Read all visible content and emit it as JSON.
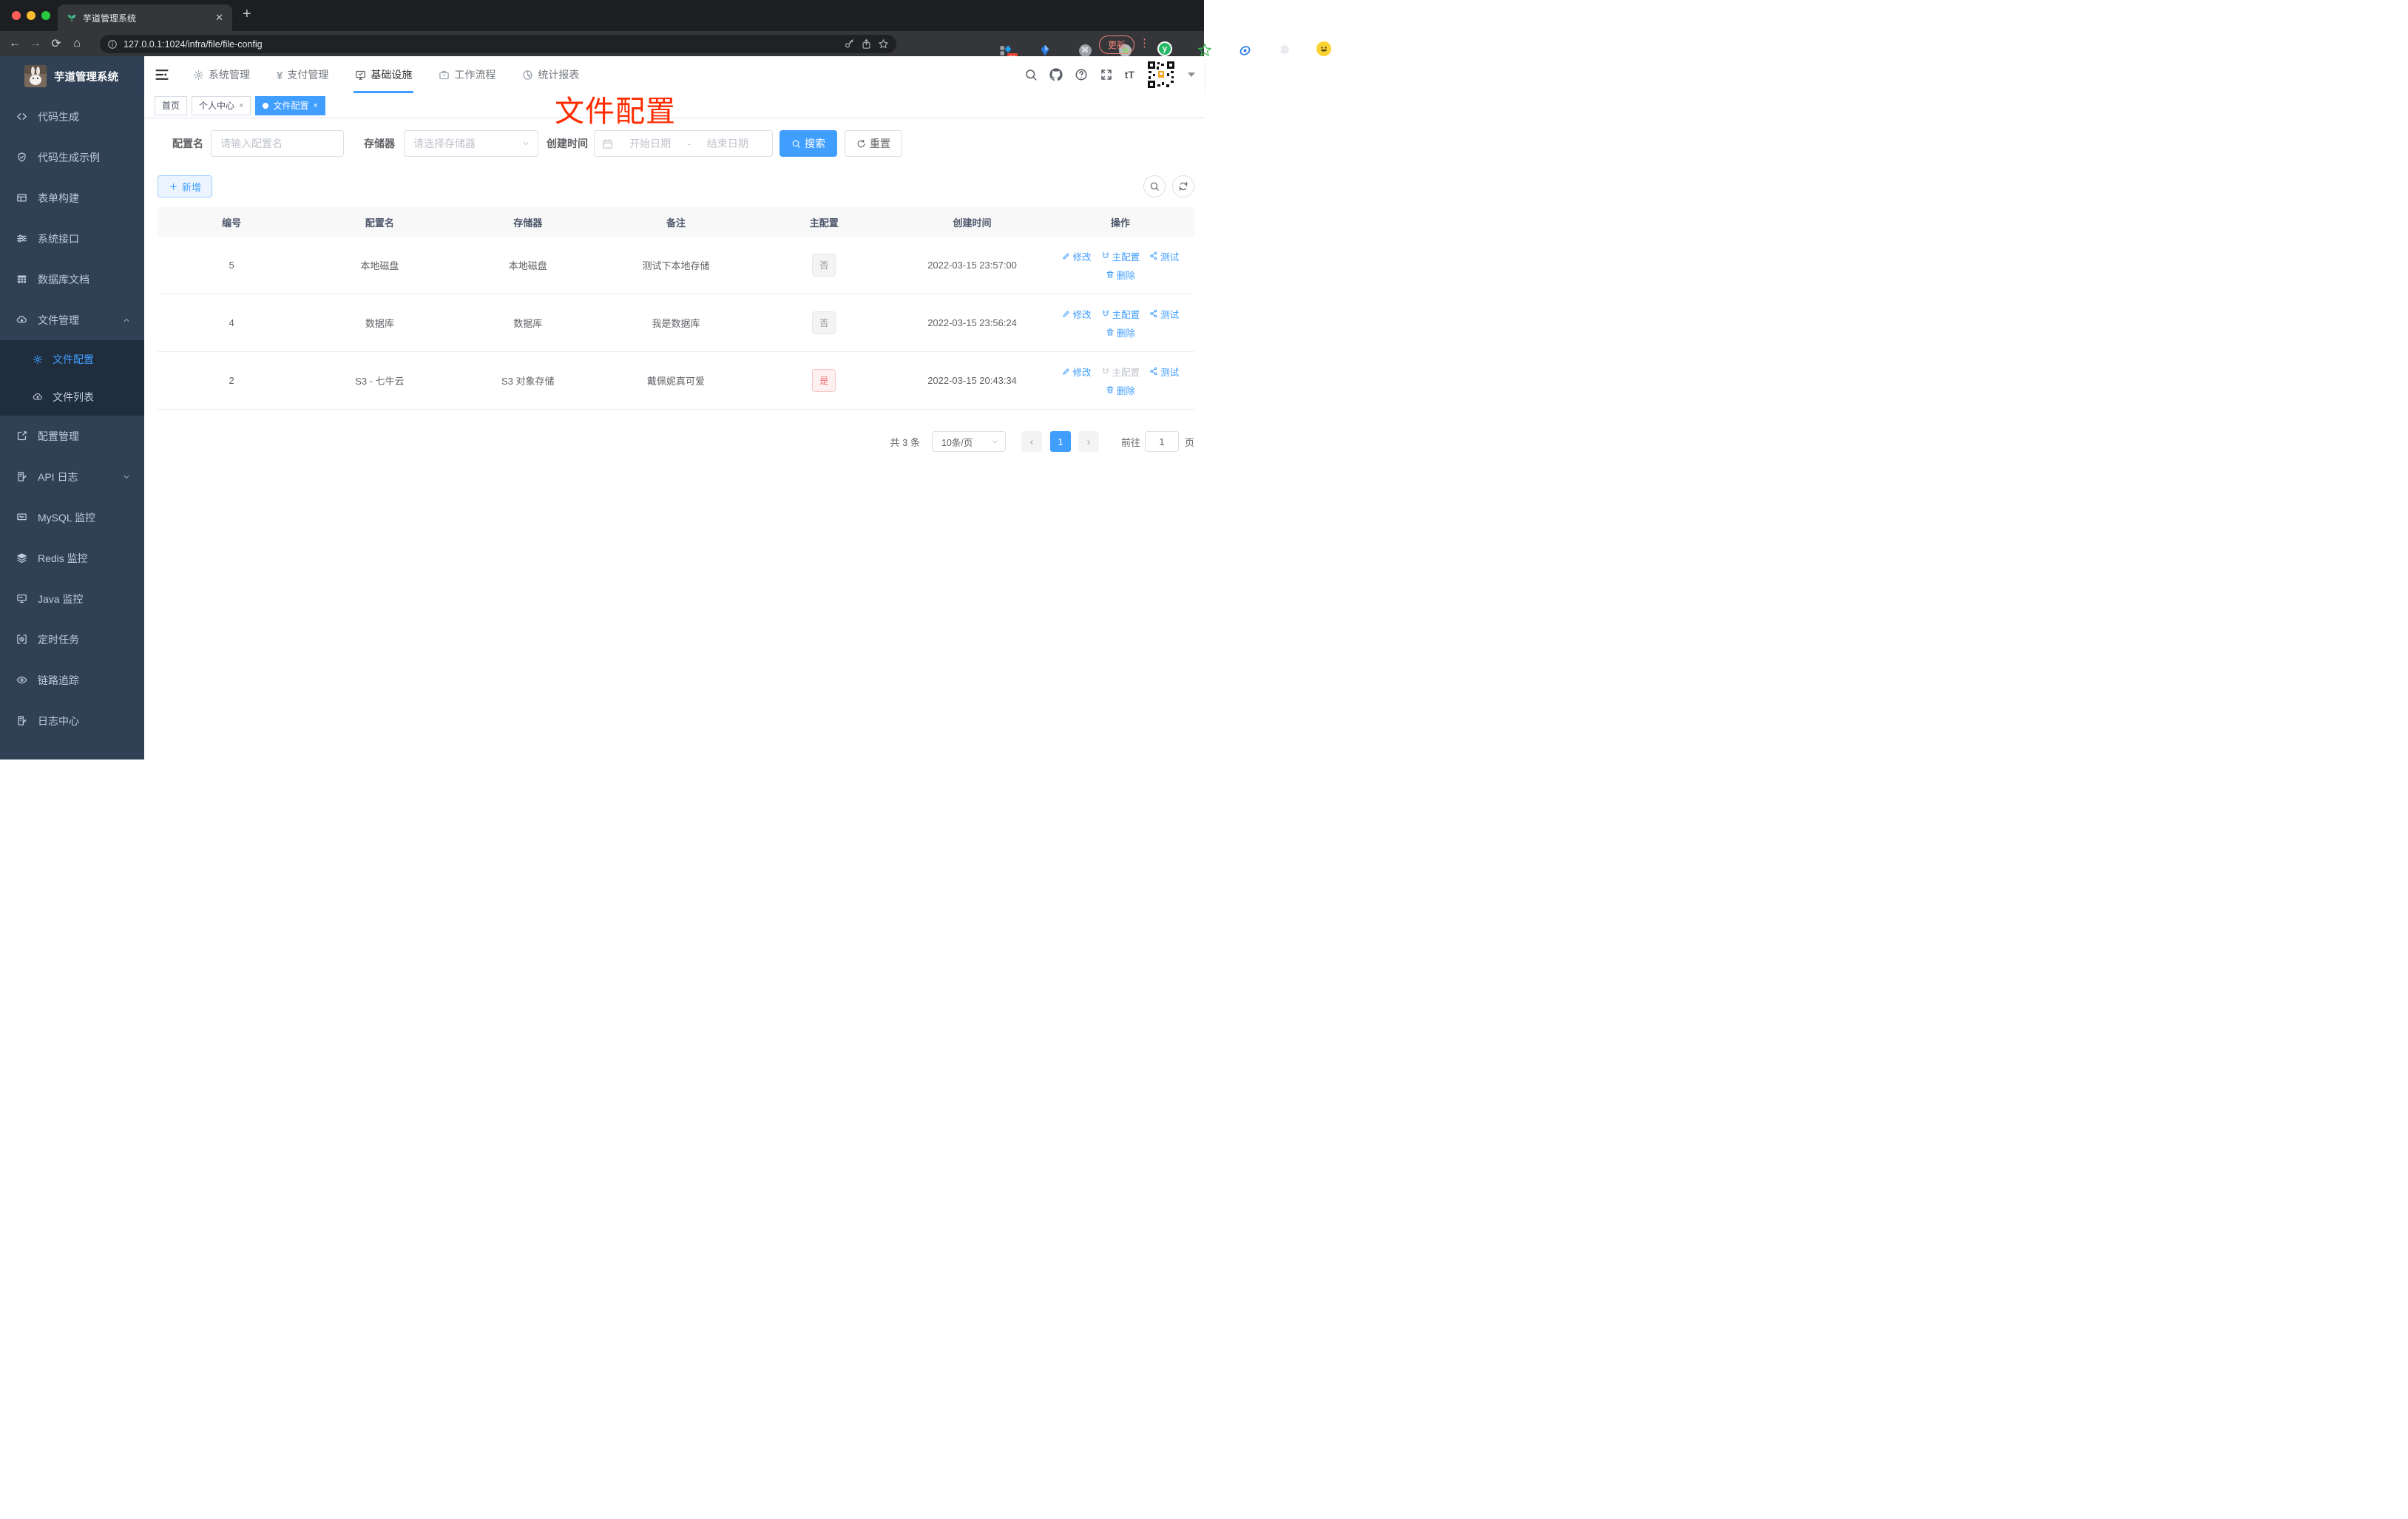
{
  "browser": {
    "tab_title": "芋道管理系统",
    "url": "127.0.0.1:1024/infra/file/file-config",
    "update_button": "更新",
    "extension_badge": "11"
  },
  "glyphs": {
    "close": "✕",
    "newtab": "+",
    "back": "←",
    "forward": "→",
    "reload": "⟳",
    "home": "⌂",
    "more": "⋮",
    "cmd": "⌘",
    "yen": "¥",
    "font_size": "tT",
    "prev": "‹",
    "next": "›",
    "dash": "-",
    "tab_close": "×"
  },
  "sidebar": {
    "title": "芋道管理系统",
    "items": [
      {
        "label": "代码生成"
      },
      {
        "label": "代码生成示例"
      },
      {
        "label": "表单构建"
      },
      {
        "label": "系统接口"
      },
      {
        "label": "数据库文档"
      },
      {
        "label": "文件管理"
      },
      {
        "label": "文件配置"
      },
      {
        "label": "文件列表"
      },
      {
        "label": "配置管理"
      },
      {
        "label": "API 日志"
      },
      {
        "label": "MySQL 监控"
      },
      {
        "label": "Redis 监控"
      },
      {
        "label": "Java 监控"
      },
      {
        "label": "定时任务"
      },
      {
        "label": "链路追踪"
      },
      {
        "label": "日志中心"
      }
    ]
  },
  "topnav": {
    "items": [
      {
        "label": "系统管理"
      },
      {
        "label": "支付管理"
      },
      {
        "label": "基础设施"
      },
      {
        "label": "工作流程"
      },
      {
        "label": "统计报表"
      }
    ]
  },
  "tags": {
    "home": "首页",
    "profile": "个人中心",
    "current": "文件配置"
  },
  "annotation": "文件配置",
  "filters": {
    "name_label": "配置名",
    "name_placeholder": "请输入配置名",
    "storage_label": "存储器",
    "storage_placeholder": "请选择存储器",
    "date_label": "创建时间",
    "date_start": "开始日期",
    "date_separator": "-",
    "date_end": "结束日期",
    "search": "搜索",
    "reset": "重置"
  },
  "toolbar": {
    "add": "新增"
  },
  "table": {
    "headers": [
      "编号",
      "配置名",
      "存储器",
      "备注",
      "主配置",
      "创建时间",
      "操作"
    ],
    "actions": {
      "edit": "修改",
      "master": "主配置",
      "test": "测试",
      "delete": "删除"
    },
    "rows": [
      {
        "id": "5",
        "name": "本地磁盘",
        "storage": "本地磁盘",
        "remark": "测试下本地存储",
        "master": "否",
        "created": "2022-03-15 23:57:00"
      },
      {
        "id": "4",
        "name": "数据库",
        "storage": "数据库",
        "remark": "我是数据库",
        "master": "否",
        "created": "2022-03-15 23:56:24"
      },
      {
        "id": "2",
        "name": "S3 - 七牛云",
        "storage": "S3 对象存储",
        "remark": "戴佩妮真可爱",
        "master": "是",
        "created": "2022-03-15 20:43:34"
      }
    ]
  },
  "pagination": {
    "total": "共 3 条",
    "page_size": "10条/页",
    "current_page": "1",
    "goto_label": "前往",
    "goto_value": "1",
    "page_unit": "页"
  },
  "colors": {
    "primary": "#409eff",
    "danger": "#f56c6c",
    "annotation_red": "#ff2b00",
    "sidebar_bg": "#304156",
    "submenu_bg": "#1f2d3d"
  }
}
